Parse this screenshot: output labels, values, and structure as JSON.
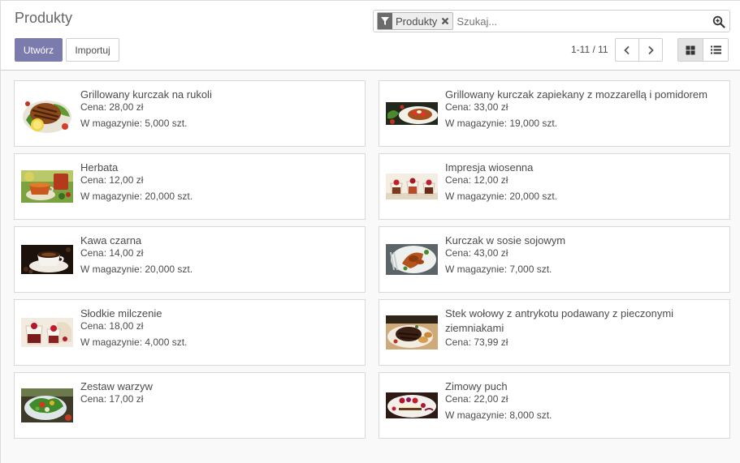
{
  "header": {
    "title": "Produkty"
  },
  "search": {
    "facet_label": "Produkty",
    "placeholder": "Szukaj..."
  },
  "buttons": {
    "create": "Utwórz",
    "import": "Importuj"
  },
  "pager": {
    "value": "1-11 / 11"
  },
  "products": [
    {
      "name": "Grillowany kurczak na rukoli",
      "price": "Cena: 28,00 zł",
      "stock": "W magazynie: 5,000 szt.",
      "image": "grilled-chicken-image"
    },
    {
      "name": "Grillowany kurczak zapiekany z mozzarellą i pomidorem",
      "price": "Cena: 33,00 zł",
      "stock": "W magazynie: 19,000 szt.",
      "image": "chicken-mozzarella-image"
    },
    {
      "name": "Herbata",
      "price": "Cena: 12,00 zł",
      "stock": "W magazynie: 20,000 szt.",
      "image": "tea-image"
    },
    {
      "name": "Impresja wiosenna",
      "price": "Cena: 12,00 zł",
      "stock": "W magazynie: 20,000 szt.",
      "image": "dessert-cups-image"
    },
    {
      "name": "Kawa czarna",
      "price": "Cena: 14,00 zł",
      "stock": "W magazynie: 20,000 szt.",
      "image": "coffee-image"
    },
    {
      "name": "Kurczak w sosie sojowym",
      "price": "Cena: 43,00 zł",
      "stock": "W magazynie: 7,000 szt.",
      "image": "soy-chicken-image"
    },
    {
      "name": "Słodkie milczenie",
      "price": "Cena: 18,00 zł",
      "stock": "W magazynie: 4,000 szt.",
      "image": "sweet-dessert-image"
    },
    {
      "name": "Stek wołowy z antrykotu podawany z pieczonymi ziemniakami",
      "price": "Cena: 73,99 zł",
      "stock": "",
      "image": "steak-image"
    },
    {
      "name": "Zestaw warzyw",
      "price": "Cena: 17,00 zł",
      "stock": "",
      "image": "vegetables-image"
    },
    {
      "name": "Zimowy puch",
      "price": "Cena: 22,00 zł",
      "stock": "W magazynie: 8,000 szt.",
      "image": "winter-cake-image"
    }
  ]
}
